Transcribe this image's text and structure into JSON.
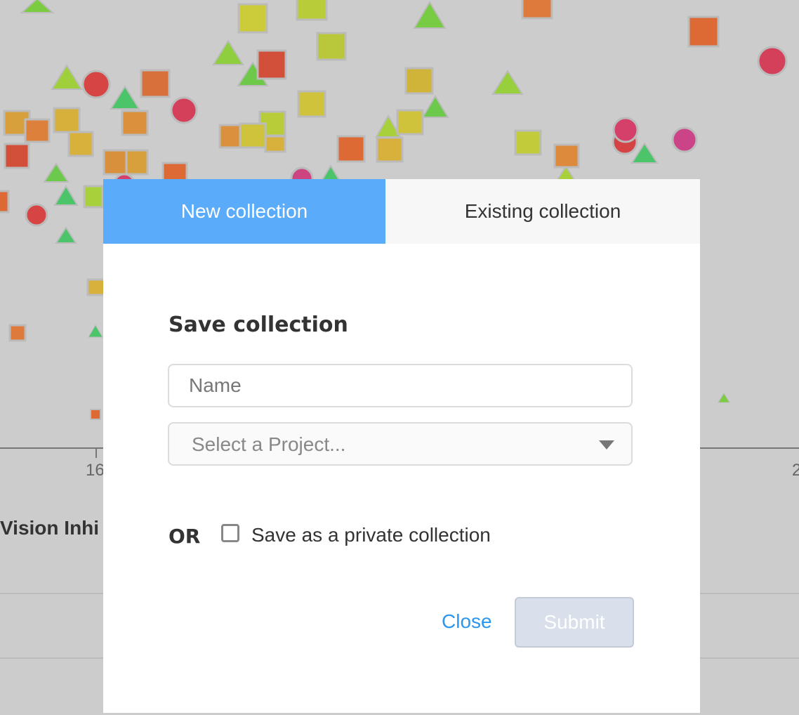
{
  "background": {
    "axis_label": "Vision Inhi",
    "tick_a": "16",
    "tick_b": "2"
  },
  "modal": {
    "tabs": [
      {
        "label": "New collection",
        "active": true
      },
      {
        "label": "Existing collection",
        "active": false
      }
    ],
    "title": "Save collection",
    "name_placeholder": "Name",
    "project_placeholder": "Select a Project...",
    "or_label": "OR",
    "private_checkbox_label": "Save as a private collection",
    "private_checked": false,
    "close_label": "Close",
    "submit_label": "Submit"
  },
  "colors": {
    "active_tab": "#5aabfa",
    "link": "#2d96ee",
    "submit_disabled": "#d9dfeb"
  }
}
